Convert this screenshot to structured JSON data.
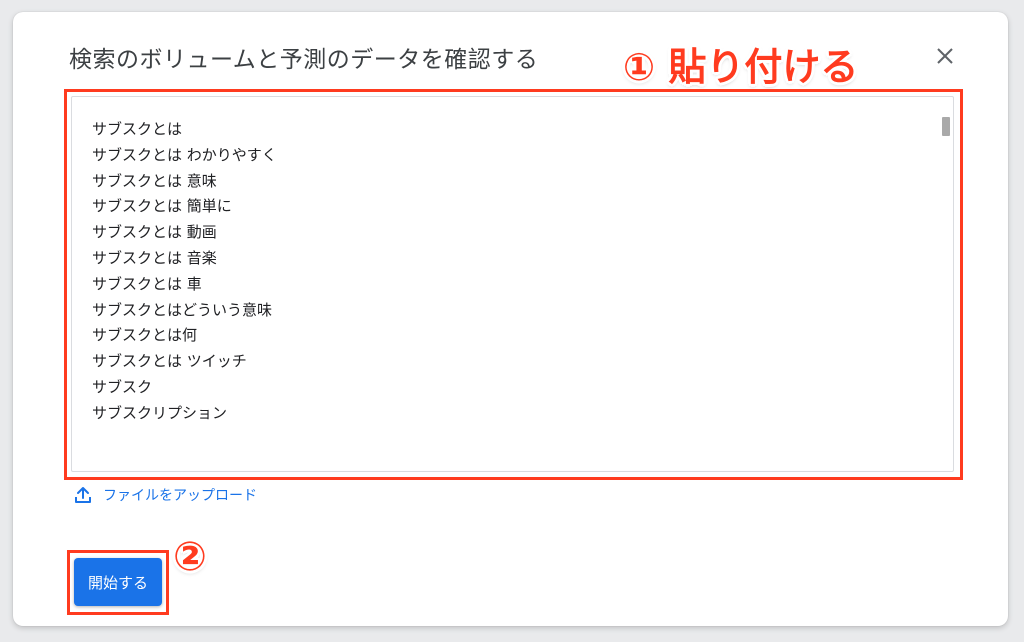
{
  "dialog": {
    "title": "検索のボリュームと予測のデータを確認する",
    "close_label": "×"
  },
  "callouts": {
    "step1": "① 貼り付ける",
    "step2": "②"
  },
  "textarea": {
    "lines": [
      "サブスクとは",
      "サブスクとは わかりやすく",
      "サブスクとは 意味",
      "サブスクとは 簡単に",
      "サブスクとは 動画",
      "サブスクとは 音楽",
      "サブスクとは 車",
      "サブスクとはどういう意味",
      "サブスクとは何",
      "サブスクとは ツイッチ",
      "サブスク",
      "サブスクリプション"
    ]
  },
  "upload": {
    "label": "ファイルをアップロード",
    "icon": "upload-icon"
  },
  "start_button": {
    "label": "開始する"
  },
  "colors": {
    "accent": "#1a73e8",
    "annotation": "#ff3b1f",
    "title_text": "#3c4043"
  }
}
